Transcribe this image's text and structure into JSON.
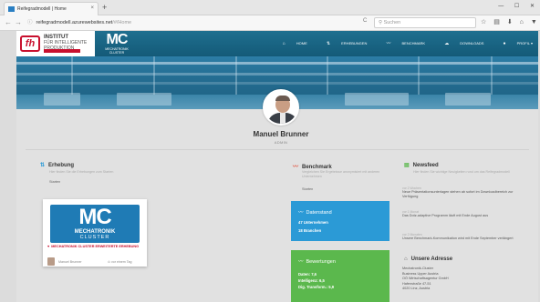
{
  "browser": {
    "tab_title": "Reifegradmodell | Home",
    "tab_close": "×",
    "new_tab": "+",
    "window_controls": [
      "—",
      "☐",
      "✕"
    ],
    "back": "←",
    "forward": "→",
    "url_host": "reifegradmodell.azurewebsites.net",
    "url_path": "/#/Home",
    "reload": "C",
    "search_placeholder": "Suchen",
    "tool_icons": [
      "☆",
      "▤",
      "⬇",
      "⌂",
      "▼"
    ]
  },
  "site_header": {
    "fh_letters": "fh",
    "fh_line1": "INSTITUT",
    "fh_line2": "FÜR INTELLIGENTE",
    "fh_line3": "PRODUKTION",
    "mc_logo": "MC",
    "mc_sub1": "MECHATRONIK",
    "mc_sub2": "CLUSTER",
    "menu": [
      {
        "icon": "⌂",
        "label": "HOME"
      },
      {
        "icon": "⇅",
        "label": "ERHEBUNGEN"
      },
      {
        "icon": "〰",
        "label": "BENCHMARK"
      },
      {
        "icon": "☁",
        "label": "DOWNLOADS"
      },
      {
        "icon": "●",
        "label": "PROFIL ▾"
      }
    ]
  },
  "profile": {
    "name": "Manuel Brunner",
    "role": "ADMIN"
  },
  "erhebung": {
    "title": "Erhebung",
    "icon": "⇅",
    "desc": "Hier finden Sie die Erhebungen zum Starten",
    "link": "Starten",
    "card": {
      "logo": "MC",
      "line1": "MECHATRONIK",
      "line2": "CLUSTER",
      "badge": "MECHATRONIK CLUSTER ERWEITERTE ERHEBUNG",
      "badge_icon": "♥",
      "author": "Manuel Brunner",
      "date": "⊙ vor einem Tag"
    }
  },
  "benchmark": {
    "title": "Benchmark",
    "icon": "〰",
    "desc": "Vergleichen Sie Ergebnisse anonymisiert mit anderen Unternehmen",
    "link": "Starten",
    "datenstand": {
      "title": "Datenstand",
      "icon": "〰",
      "line1": "47 Unternehmen",
      "line2": "18 Branchen"
    },
    "bewertungen": {
      "title": "Bewertungen",
      "icon": "〰",
      "line1": "Daten: 7,6",
      "line2": "Intelligenz: 6,5",
      "line3": "Dig. Transform.: 5,9"
    }
  },
  "newsfeed": {
    "title": "Newsfeed",
    "icon": "▤",
    "desc": "Hier finden Sie wichtige Neuigkeiten rund um das Reifegradmodell",
    "items": [
      {
        "date": "vor 2 Wochen",
        "text": "Neue Präsentationsunterlagen stehen ab sofort im Downloadbereich zur Verfügung"
      },
      {
        "date": "vor 1 Monat",
        "text": "Das Dotz-adaptive Programm läuft mit Ende August aus"
      },
      {
        "date": "vor 2 Monaten",
        "text": "Unsere Benchmark-Kommunikation wird mit Ende September verlängert"
      }
    ],
    "address_title": "Unsere Adresse",
    "address_icon": "⌂",
    "address_lines": [
      "Mechatronik-Cluster",
      "Business Upper Austria",
      "OÖ Wirtschaftsagentur GmbH",
      "Hafenstraße 47-51",
      "4020 Linz, Austria"
    ]
  }
}
